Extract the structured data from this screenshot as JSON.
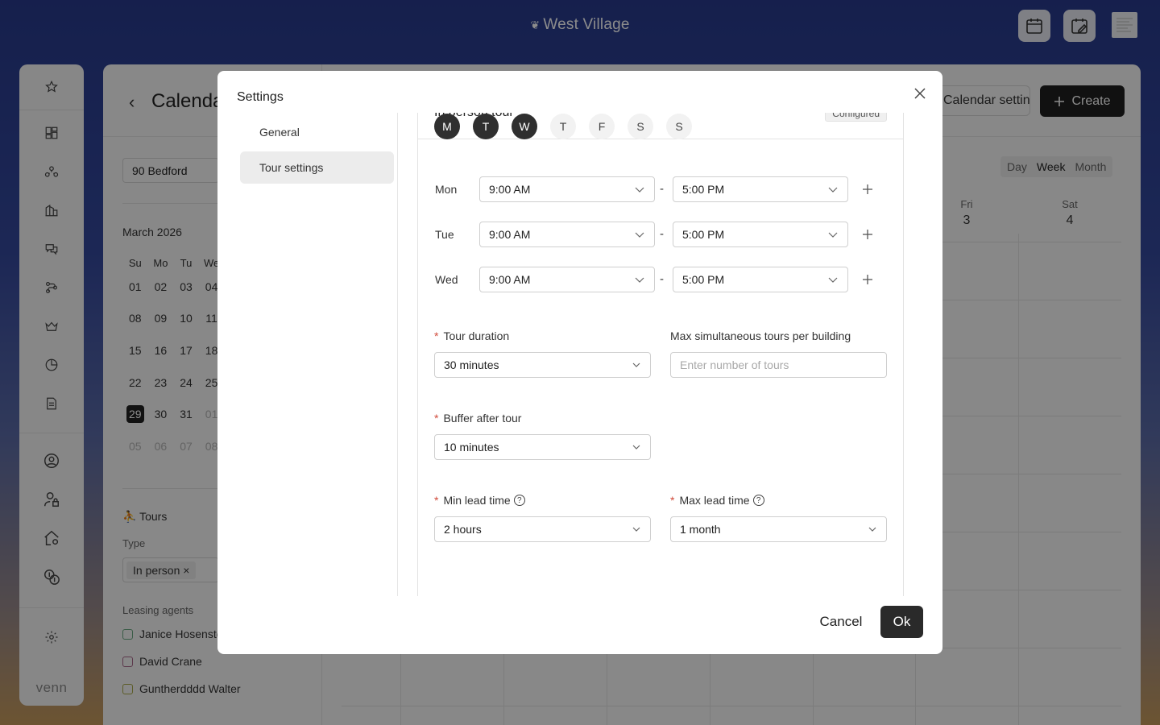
{
  "topbar": {
    "brand_mark": "❦",
    "brand": "West Village",
    "icons": [
      "calendar-icon",
      "calendar-edit-icon",
      "document-icon"
    ]
  },
  "sidebar": {
    "items": [
      "star-icon",
      "dashboard-icon",
      "network-icon",
      "buildings-icon",
      "chat-icon",
      "workflow-icon",
      "crown-icon",
      "pie-chart-icon",
      "document-icon",
      "user-circle-icon",
      "user-lock-icon",
      "home-gear-icon",
      "money-icon",
      "settings-icon"
    ],
    "logo": "venn"
  },
  "calendar": {
    "back": "‹",
    "title": "Calendar",
    "settings_button": "Calendar settings",
    "create_button": "Create",
    "building": "90 Bedford",
    "month": "March 2026",
    "weekdays": [
      "Su",
      "Mo",
      "Tu",
      "We"
    ],
    "weeks": [
      [
        "01",
        "02",
        "03",
        "04"
      ],
      [
        "08",
        "09",
        "10",
        "11"
      ],
      [
        "15",
        "16",
        "17",
        "18"
      ],
      [
        "22",
        "23",
        "24",
        "25"
      ],
      [
        "29",
        "30",
        "31",
        "01"
      ],
      [
        "05",
        "06",
        "07",
        "08"
      ]
    ],
    "selected_day": "29",
    "tours_heading": "Tours",
    "type_label": "Type",
    "type_tag": "In person",
    "agents_label": "Leasing agents",
    "agents": [
      {
        "name": "Janice Hosenstein",
        "color": "#6aa882"
      },
      {
        "name": "David Crane",
        "color": "#a8688a"
      },
      {
        "name": "Guntherdddd Walter",
        "color": "#a8a848"
      }
    ],
    "views": [
      "Day",
      "Week",
      "Month"
    ],
    "active_view": "Week",
    "columns": [
      {
        "day": "Fri",
        "date": "3"
      },
      {
        "day": "Sat",
        "date": "4"
      }
    ]
  },
  "modal": {
    "title": "Settings",
    "nav": [
      "General",
      "Tour settings"
    ],
    "active_nav": "Tour settings",
    "section_title": "In person tour",
    "section_badge": "Configured",
    "days": [
      {
        "label": "M",
        "on": true
      },
      {
        "label": "T",
        "on": true
      },
      {
        "label": "W",
        "on": true
      },
      {
        "label": "T",
        "on": false
      },
      {
        "label": "F",
        "on": false
      },
      {
        "label": "S",
        "on": false
      },
      {
        "label": "S",
        "on": false
      }
    ],
    "schedule": [
      {
        "day": "Mon",
        "start": "9:00 AM",
        "end": "5:00 PM"
      },
      {
        "day": "Tue",
        "start": "9:00 AM",
        "end": "5:00 PM"
      },
      {
        "day": "Wed",
        "start": "9:00 AM",
        "end": "5:00 PM"
      }
    ],
    "separator": "-",
    "tour_duration": {
      "label": "Tour duration",
      "value": "30 minutes"
    },
    "max_simultaneous": {
      "label": "Max simultaneous tours per building",
      "placeholder": "Enter number of tours"
    },
    "buffer_after": {
      "label": "Buffer after tour",
      "value": "10 minutes"
    },
    "min_lead": {
      "label": "Min lead time",
      "value": "2 hours"
    },
    "max_lead": {
      "label": "Max lead time",
      "value": "1 month"
    },
    "help_glyph": "?",
    "required_mark": "*",
    "cancel": "Cancel",
    "ok": "Ok"
  }
}
